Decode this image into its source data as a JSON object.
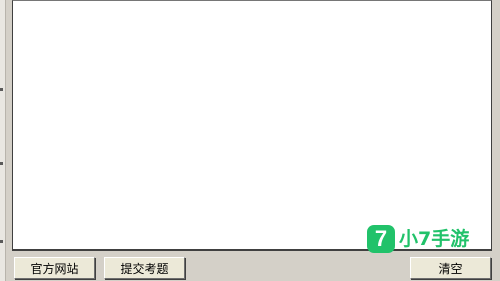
{
  "editor": {
    "content": ""
  },
  "buttons": {
    "official_site_label": "官方网站",
    "submit_question_label": "提交考题",
    "clear_label": "清空"
  },
  "watermark": {
    "logo_glyph": "7",
    "text": "小7手游",
    "color": "#21c26a"
  }
}
